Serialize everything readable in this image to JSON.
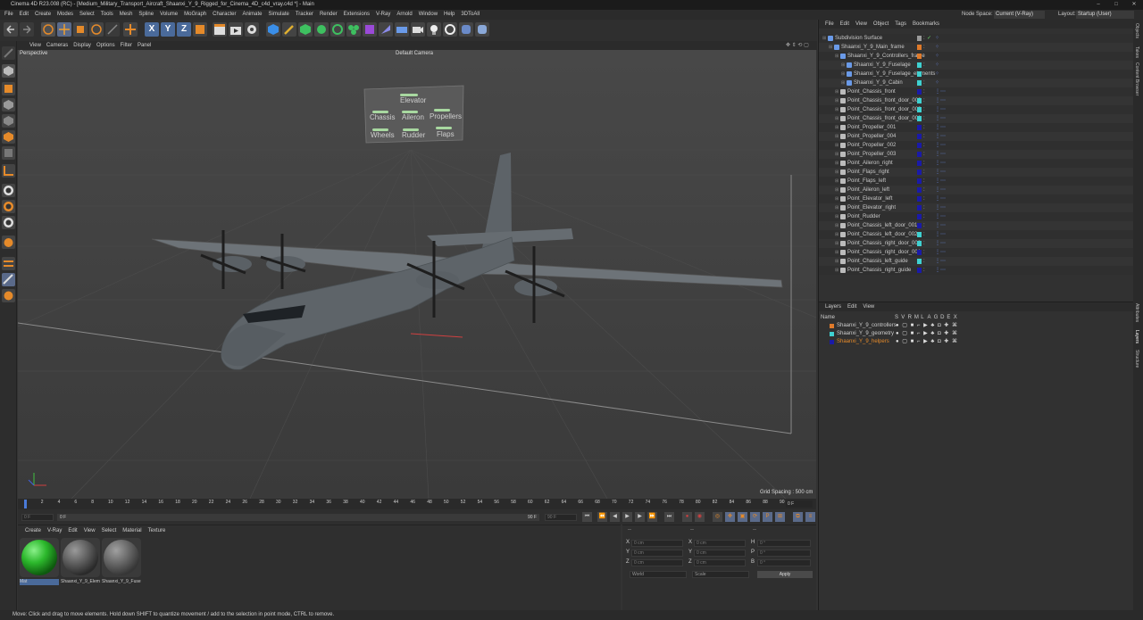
{
  "window": {
    "title": "Cinema 4D R23.008 (RC) - [Medium_Military_Transport_Aircraft_Shaanxi_Y_9_Rigged_for_Cinema_4D_c4d_vray.c4d *] - Main",
    "minimize": "–",
    "maximize": "□",
    "close": "✕"
  },
  "menubar": {
    "items": [
      "File",
      "Edit",
      "Create",
      "Modes",
      "Select",
      "Tools",
      "Mesh",
      "Spline",
      "Volume",
      "MoGraph",
      "Character",
      "Animate",
      "Simulate",
      "Tracker",
      "Render",
      "Extensions",
      "V-Ray",
      "Arnold",
      "Window",
      "Help",
      "3DToAll"
    ],
    "node_space_label": "Node Space:",
    "node_space_value": "Current (V-Ray)",
    "layout_label": "Layout:",
    "layout_value": "Startup (User)"
  },
  "toolbar": {
    "axis_x": "X",
    "axis_y": "Y",
    "axis_z": "Z"
  },
  "viewport": {
    "menu": [
      "View",
      "Cameras",
      "Display",
      "Options",
      "Filter",
      "Panel"
    ],
    "name": "Perspective",
    "camera": "Default Camera",
    "grid_spacing": "Grid Spacing : 500 cm",
    "hud_buttons": [
      "Elevator",
      "Chassis",
      "Aileron",
      "Propellers",
      "Wheels",
      "Rudder",
      "Flaps"
    ]
  },
  "timeline": {
    "ticks": [
      "0",
      "2",
      "4",
      "6",
      "8",
      "10",
      "12",
      "14",
      "16",
      "18",
      "20",
      "22",
      "24",
      "26",
      "28",
      "30",
      "32",
      "34",
      "36",
      "38",
      "40",
      "42",
      "44",
      "46",
      "48",
      "50",
      "52",
      "54",
      "56",
      "58",
      "60",
      "62",
      "64",
      "66",
      "68",
      "70",
      "72",
      "74",
      "76",
      "78",
      "80",
      "82",
      "84",
      "86",
      "88",
      "90"
    ],
    "current_frame": "0 F"
  },
  "transport": {
    "start_field": "0 F",
    "current_field": "0 F",
    "end_field": "90 F",
    "end_field2": "90 F"
  },
  "materials": {
    "menu": [
      "Create",
      "V-Ray",
      "Edit",
      "View",
      "Select",
      "Material",
      "Texture"
    ],
    "items": [
      {
        "label": "Mat"
      },
      {
        "label": "Shaanxi_Y_9_Elem"
      },
      {
        "label": "Shaanxi_Y_9_Fuse"
      }
    ]
  },
  "coordinates": {
    "header_dashes": [
      "--",
      "--",
      "--"
    ],
    "rows": [
      {
        "axis": "X",
        "pos": "0 cm",
        "size_axis": "X",
        "size": "0 cm",
        "rot_axis": "H",
        "rot": "0 °"
      },
      {
        "axis": "Y",
        "pos": "0 cm",
        "size_axis": "Y",
        "size": "0 cm",
        "rot_axis": "P",
        "rot": "0 °"
      },
      {
        "axis": "Z",
        "pos": "0 cm",
        "size_axis": "Z",
        "size": "0 cm",
        "rot_axis": "B",
        "rot": "0 °"
      }
    ],
    "mode_world": "World",
    "mode_scale": "Scale",
    "apply": "Apply"
  },
  "object_manager": {
    "menu": [
      "File",
      "Edit",
      "View",
      "Object",
      "Tags",
      "Bookmarks"
    ],
    "objects": [
      {
        "name": "Subdivision Surface",
        "indent": 0,
        "color": "#9a9a9a"
      },
      {
        "name": "Shaanxi_Y_9_Main_frame",
        "indent": 1,
        "color": "#e07a2a"
      },
      {
        "name": "Shaanxi_Y_9_Controllers_frame",
        "indent": 2,
        "color": "#e07a2a"
      },
      {
        "name": "Shaanxi_Y_9_Fuselage",
        "indent": 3,
        "color": "#3fd1d1"
      },
      {
        "name": "Shaanxi_Y_9_Fuselage_elements",
        "indent": 3,
        "color": "#3fd1d1"
      },
      {
        "name": "Shaanxi_Y_9_Cabin",
        "indent": 3,
        "color": "#3fd1d1"
      },
      {
        "name": "Point_Chassis_front",
        "indent": 2,
        "color": "#1a1aa8"
      },
      {
        "name": "Point_Chassis_front_door_002",
        "indent": 2,
        "color": "#3fd1d1"
      },
      {
        "name": "Point_Chassis_front_door_003",
        "indent": 2,
        "color": "#3fd1d1"
      },
      {
        "name": "Point_Chassis_front_door_001",
        "indent": 2,
        "color": "#3fd1d1"
      },
      {
        "name": "Point_Propeller_001",
        "indent": 2,
        "color": "#1a1aa8"
      },
      {
        "name": "Point_Propeller_004",
        "indent": 2,
        "color": "#1a1aa8"
      },
      {
        "name": "Point_Propeller_002",
        "indent": 2,
        "color": "#1a1aa8"
      },
      {
        "name": "Point_Propeller_003",
        "indent": 2,
        "color": "#1a1aa8"
      },
      {
        "name": "Point_Aileron_right",
        "indent": 2,
        "color": "#1a1aa8"
      },
      {
        "name": "Point_Flaps_right",
        "indent": 2,
        "color": "#1a1aa8"
      },
      {
        "name": "Point_Flaps_left",
        "indent": 2,
        "color": "#1a1aa8"
      },
      {
        "name": "Point_Aileron_left",
        "indent": 2,
        "color": "#1a1aa8"
      },
      {
        "name": "Point_Elevator_left",
        "indent": 2,
        "color": "#1a1aa8"
      },
      {
        "name": "Point_Elevator_right",
        "indent": 2,
        "color": "#1a1aa8"
      },
      {
        "name": "Point_Rudder",
        "indent": 2,
        "color": "#1a1aa8"
      },
      {
        "name": "Point_Chassis_left_door_001",
        "indent": 2,
        "color": "#1a1aa8"
      },
      {
        "name": "Point_Chassis_left_door_002",
        "indent": 2,
        "color": "#3fd1d1"
      },
      {
        "name": "Point_Chassis_right_door_002",
        "indent": 2,
        "color": "#3fd1d1"
      },
      {
        "name": "Point_Chassis_right_door_001",
        "indent": 2,
        "color": "#1a1aa8"
      },
      {
        "name": "Point_Chassis_left_guide",
        "indent": 2,
        "color": "#3fd1d1"
      },
      {
        "name": "Point_Chassis_right_guide",
        "indent": 2,
        "color": "#1a1aa8"
      }
    ]
  },
  "layer_manager": {
    "menu": [
      "Layers",
      "Edit",
      "View"
    ],
    "header_name": "Name",
    "header_flags": [
      "S",
      "V",
      "R",
      "M",
      "L",
      "A",
      "G",
      "D",
      "E",
      "X"
    ],
    "layers": [
      {
        "name": "Shaanxi_Y_9_controllers",
        "color": "#e07a2a"
      },
      {
        "name": "Shaanxi_Y_9_geometry",
        "color": "#3fd1d1"
      },
      {
        "name": "Shaanxi_Y_9_helpers",
        "color": "#1a1aa8"
      }
    ]
  },
  "right_tabs": [
    "Objects",
    "Takes",
    "Content Browser",
    "Attributes",
    "Layers",
    "Structure"
  ],
  "status": {
    "text": "Move: Click and drag to move elements. Hold down SHIFT to quantize movement / add to the selection in point mode, CTRL to remove."
  }
}
